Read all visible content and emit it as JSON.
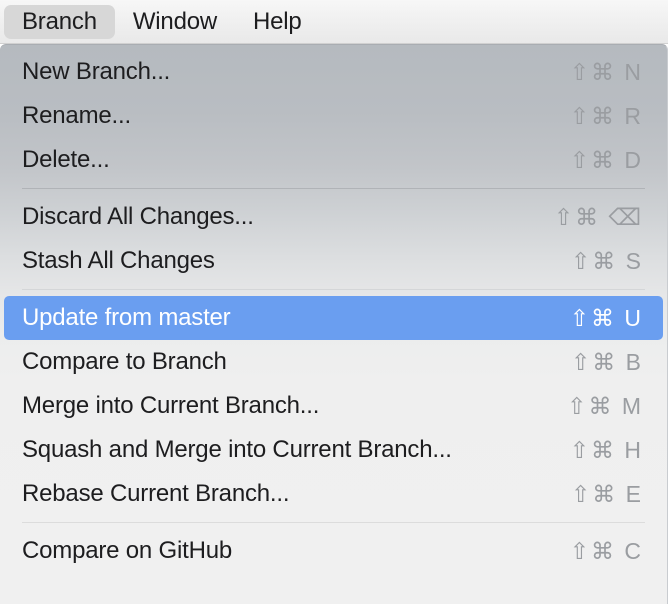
{
  "menubar": {
    "items": [
      {
        "label": "Branch",
        "active": true
      },
      {
        "label": "Window",
        "active": false
      },
      {
        "label": "Help",
        "active": false
      }
    ]
  },
  "menu": {
    "title": "Branch",
    "highlight_color": "#6a9ef0",
    "groups": [
      {
        "items": [
          {
            "label": "New Branch...",
            "shortcut": "⇧⌘ N",
            "selected": false
          },
          {
            "label": "Rename...",
            "shortcut": "⇧⌘ R",
            "selected": false
          },
          {
            "label": "Delete...",
            "shortcut": "⇧⌘ D",
            "selected": false
          }
        ]
      },
      {
        "items": [
          {
            "label": "Discard All Changes...",
            "shortcut": "⇧⌘ ⌫",
            "selected": false
          },
          {
            "label": "Stash All Changes",
            "shortcut": "⇧⌘ S",
            "selected": false
          }
        ]
      },
      {
        "items": [
          {
            "label": "Update from master",
            "shortcut": "⇧⌘ U",
            "selected": true
          },
          {
            "label": "Compare to Branch",
            "shortcut": "⇧⌘ B",
            "selected": false
          },
          {
            "label": "Merge into Current Branch...",
            "shortcut": "⇧⌘ M",
            "selected": false
          },
          {
            "label": "Squash and Merge into Current Branch...",
            "shortcut": "⇧⌘ H",
            "selected": false
          },
          {
            "label": "Rebase Current Branch...",
            "shortcut": "⇧⌘ E",
            "selected": false
          }
        ]
      },
      {
        "items": [
          {
            "label": "Compare on GitHub",
            "shortcut": "⇧⌘ C",
            "selected": false
          }
        ]
      }
    ]
  }
}
